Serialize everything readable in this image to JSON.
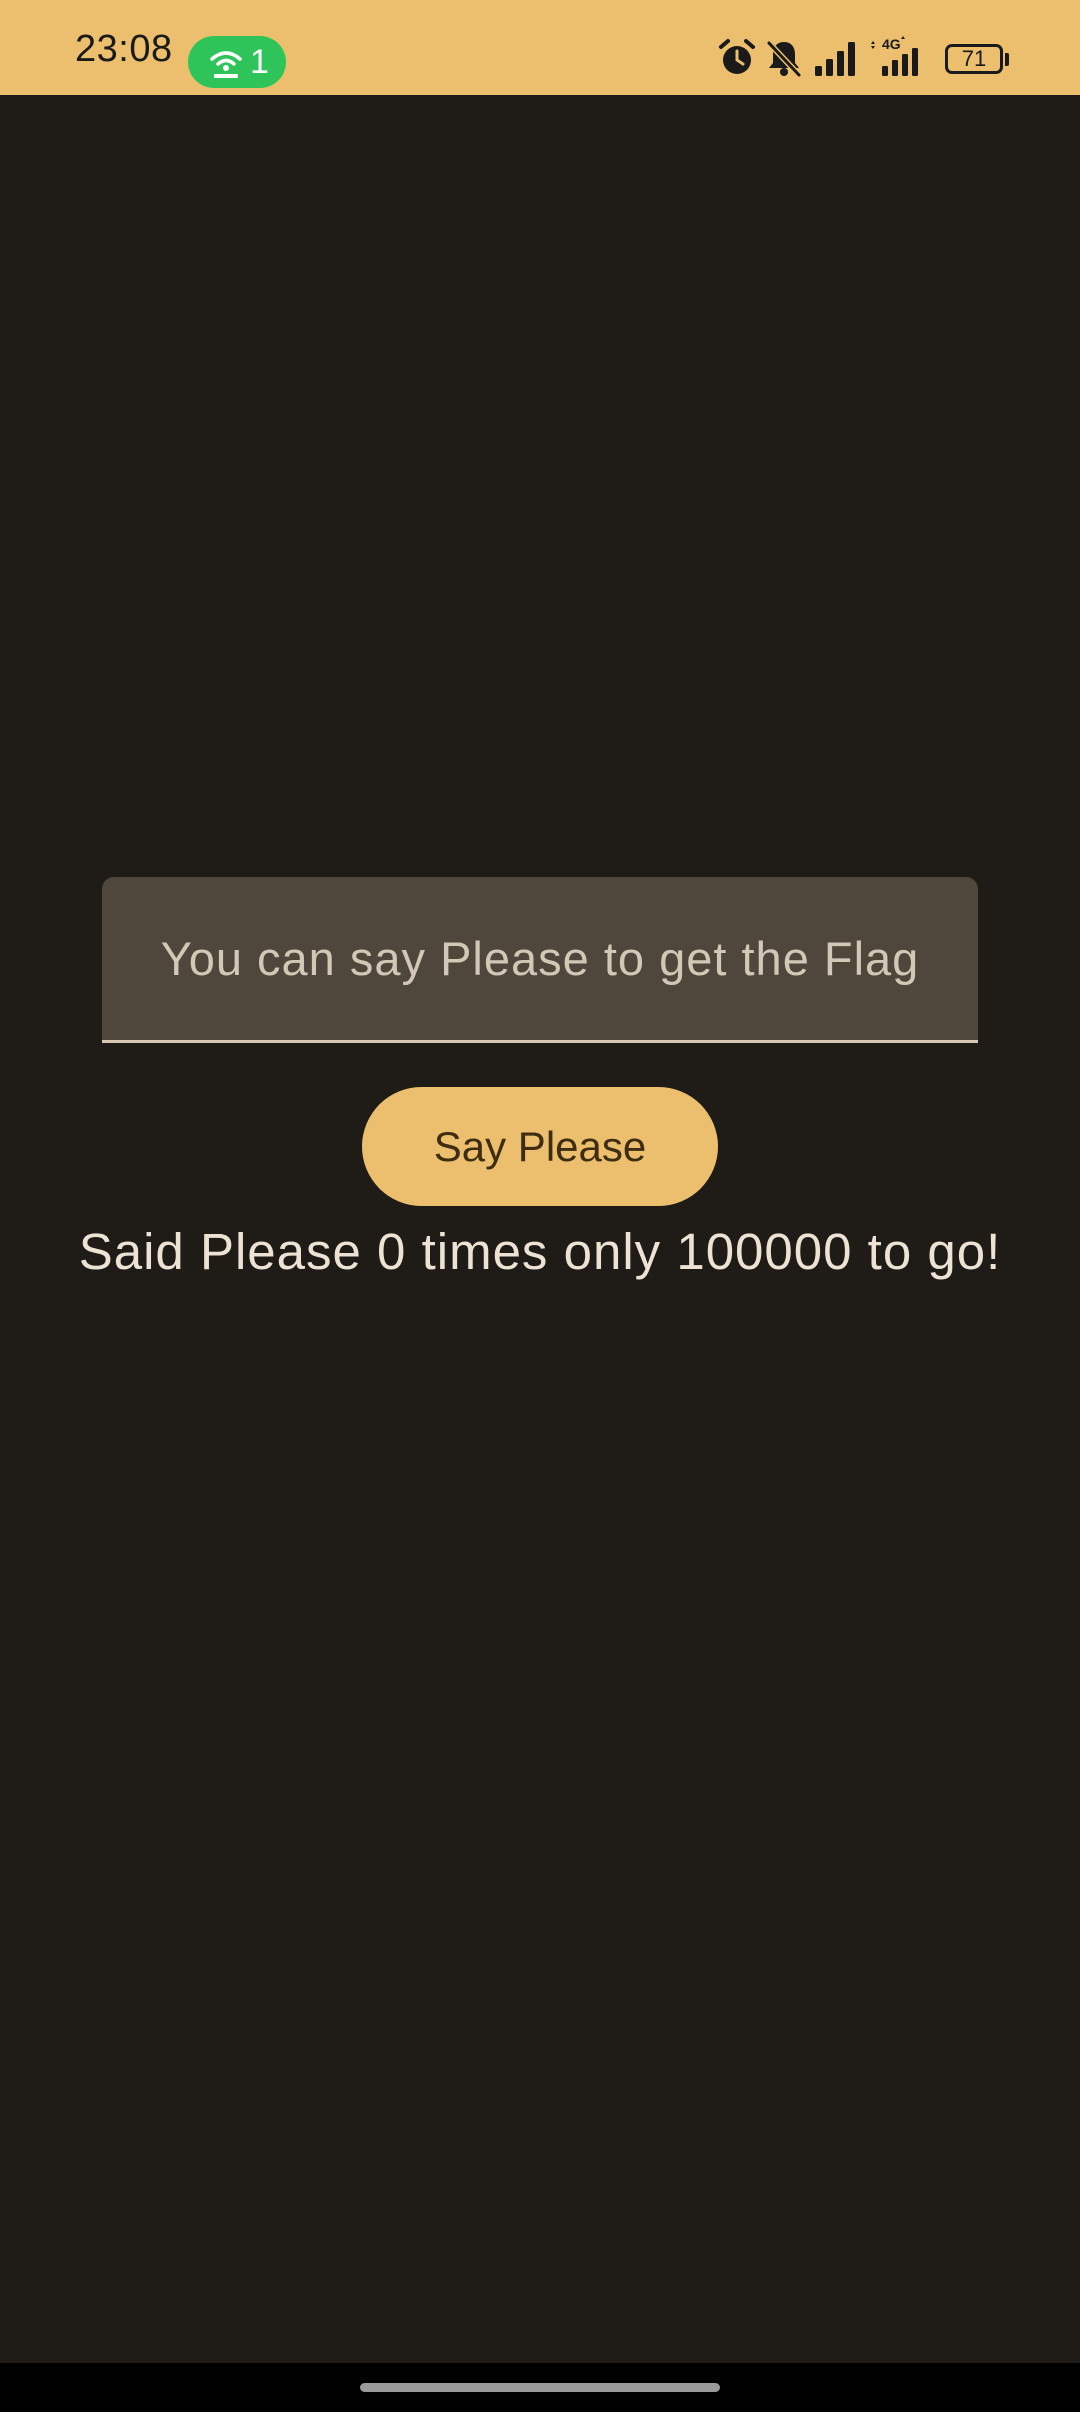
{
  "status_bar": {
    "time": "23:08",
    "hotspot_count": "1",
    "battery_level": "71",
    "network_label": "4G",
    "icons": [
      "hotspot-icon",
      "alarm-icon",
      "bell-off-icon",
      "signal-icon",
      "signal-4g-icon",
      "battery-icon"
    ],
    "background_color": "#ebbf6d",
    "hotspot_color": "#2ec45a"
  },
  "main": {
    "input": {
      "placeholder": "You can say Please to get the Flag",
      "value": ""
    },
    "button_label": "Say Please",
    "counter_text": "Said Please 0 times only 100000 to go!"
  },
  "colors": {
    "background": "#1f1b17",
    "accent": "#ebbf6d",
    "field_background": "#4f473c",
    "text_primary": "#ede3d5"
  }
}
